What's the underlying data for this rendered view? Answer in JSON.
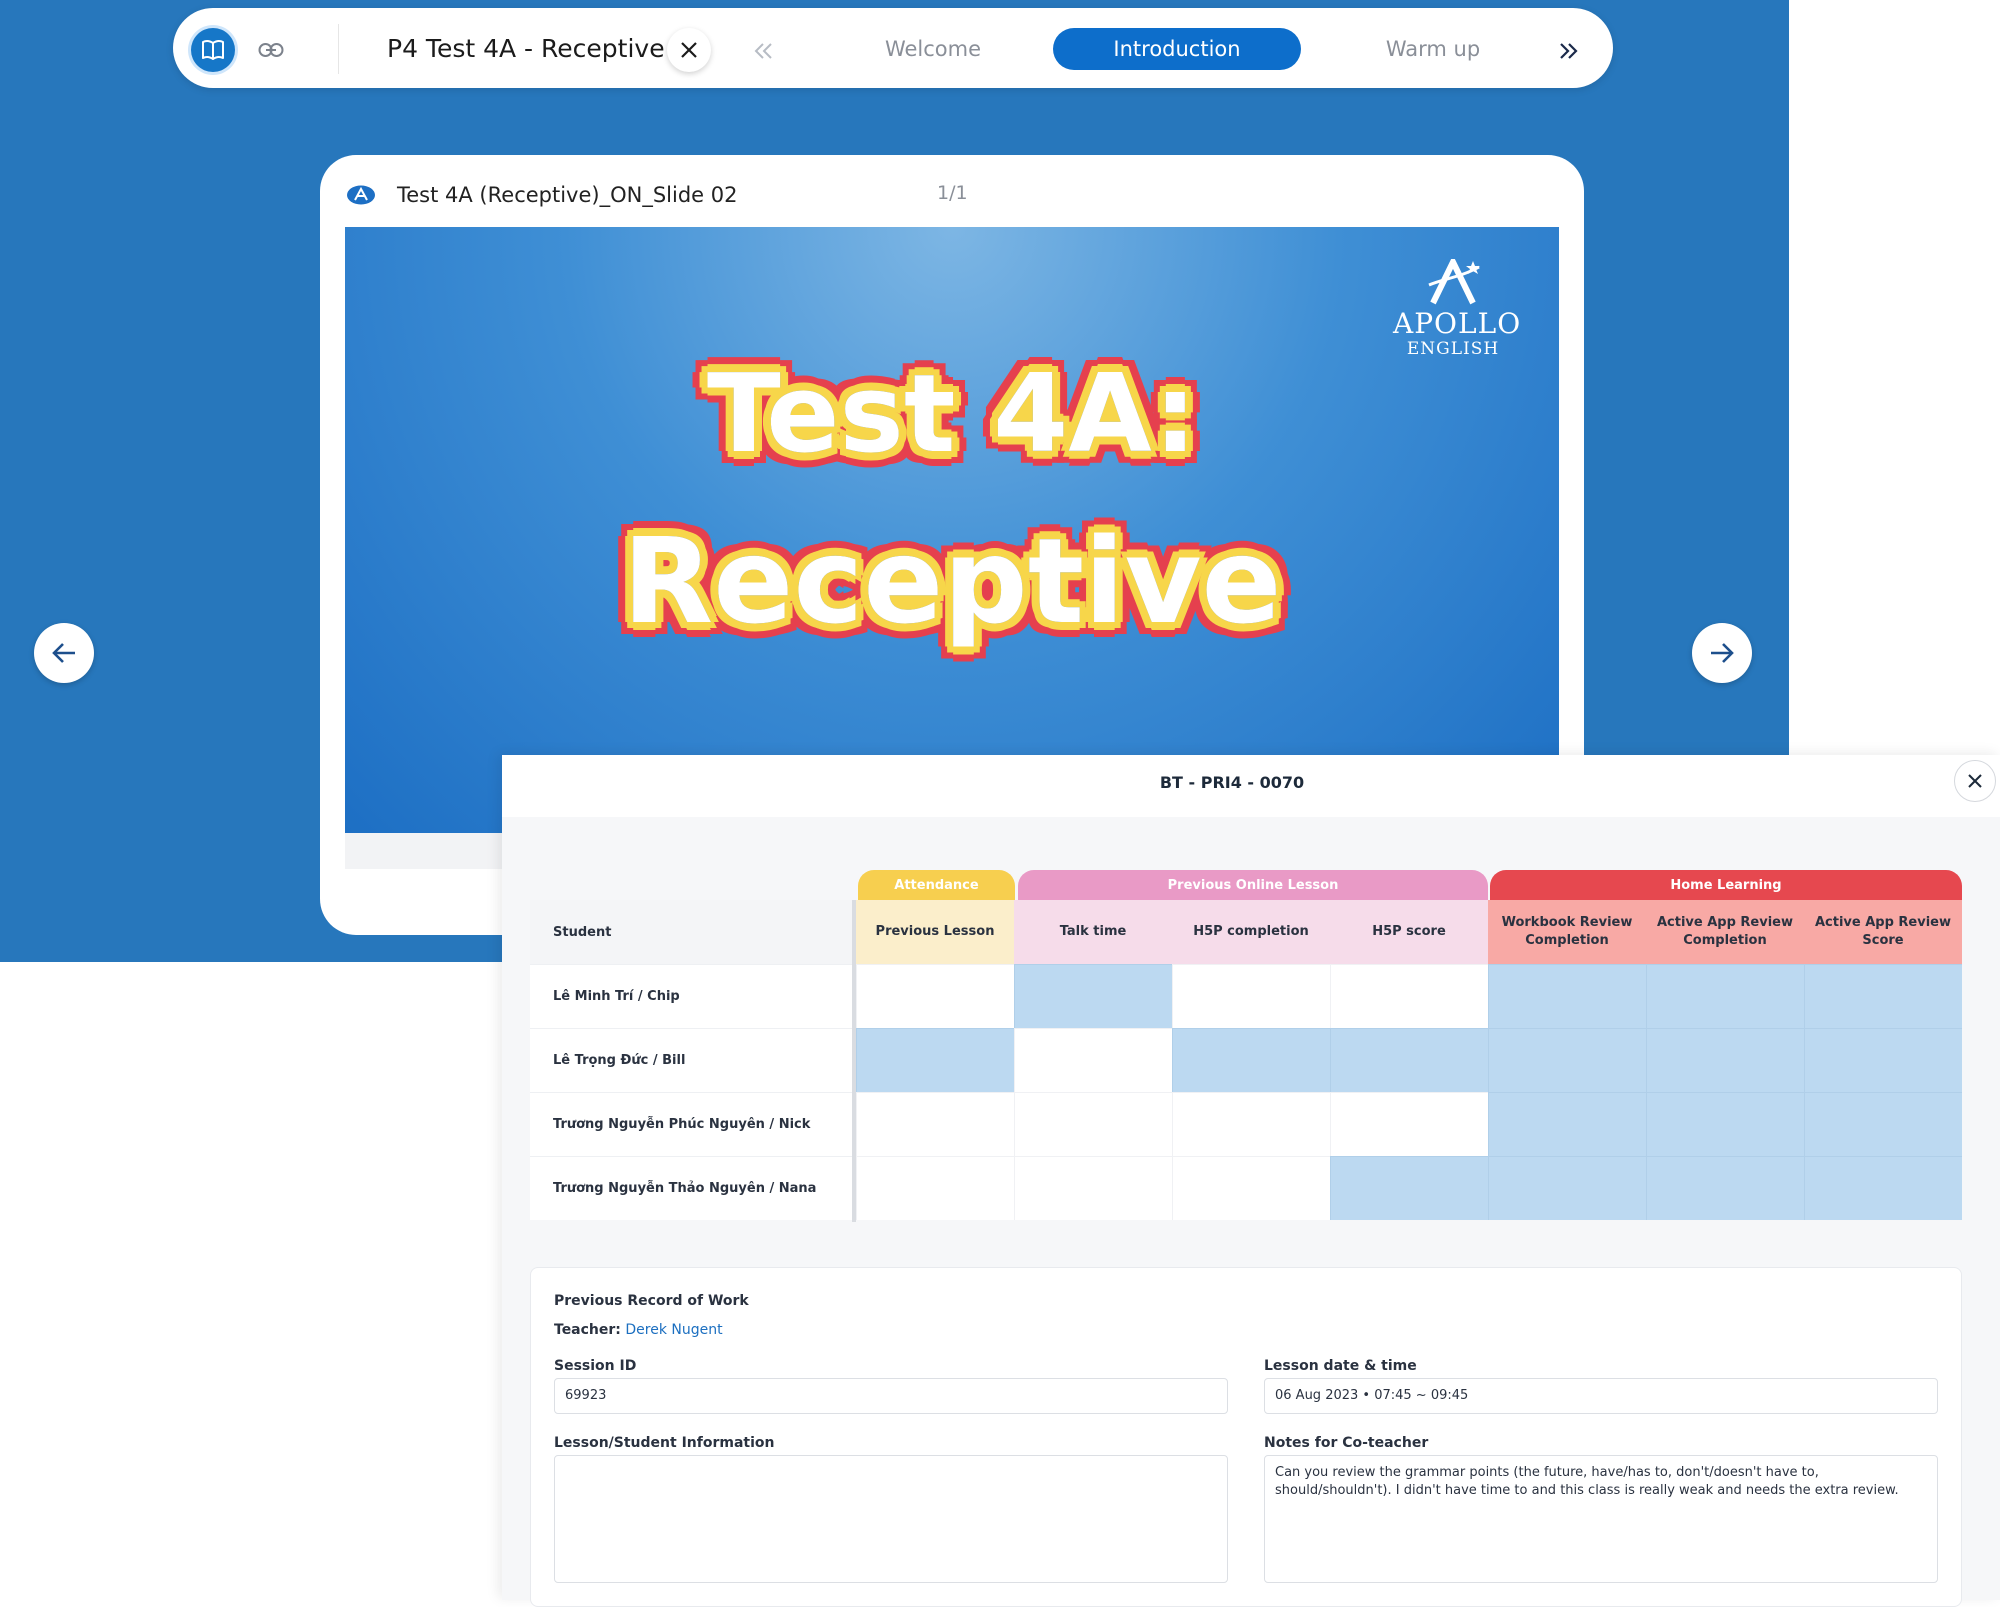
{
  "topbar": {
    "lesson_title": "P4 Test 4A - Receptive",
    "tabs": [
      {
        "label": "Welcome",
        "active": false
      },
      {
        "label": "Introduction",
        "active": true
      },
      {
        "label": "Warm up",
        "active": false
      }
    ],
    "icons": [
      "book-icon",
      "link-icon",
      "close-icon",
      "chevrons-left-icon",
      "chevrons-right-icon"
    ]
  },
  "slide": {
    "name": "Test 4A (Receptive)_ON_Slide 02",
    "counter": "1/1",
    "brand_name": "APOLLO",
    "brand_sub": "ENGLISH",
    "title_line1": "Test 4A:",
    "title_line2": "Receptive"
  },
  "panel": {
    "title": "BT - PRI4 - 0070",
    "groups": [
      {
        "label": "Attendance",
        "color": "#f7cf4f"
      },
      {
        "label": "Previous Online Lesson",
        "color": "#e99ac6"
      },
      {
        "label": "Home Learning",
        "color": "#e6484f"
      }
    ],
    "student_header": "Student",
    "columns": [
      {
        "label": "Previous Lesson",
        "bg": "#fbeecb"
      },
      {
        "label": "Talk time",
        "bg": "#f6dcea"
      },
      {
        "label": "H5P completion",
        "bg": "#f6dcea"
      },
      {
        "label": "H5P score",
        "bg": "#f6dcea"
      },
      {
        "label": "Workbook Review Completion",
        "bg": "#f8a9a5"
      },
      {
        "label": "Active App Review Completion",
        "bg": "#f8a9a5"
      },
      {
        "label": "Active App Review Score",
        "bg": "#f8a9a5"
      }
    ],
    "students": [
      {
        "name": "Lê Minh Trí / Chip",
        "highlights": [
          false,
          true,
          false,
          false,
          true,
          true,
          true
        ]
      },
      {
        "name": "Lê Trọng Đức / Bill",
        "highlights": [
          true,
          false,
          true,
          true,
          true,
          true,
          true
        ]
      },
      {
        "name": "Trương Nguyễn Phúc Nguyên / Nick",
        "highlights": [
          false,
          false,
          false,
          false,
          true,
          true,
          true
        ]
      },
      {
        "name": "Trương Nguyễn Thảo Nguyên / Nana",
        "highlights": [
          false,
          false,
          false,
          true,
          true,
          true,
          true
        ]
      }
    ],
    "record": {
      "heading": "Previous Record of Work",
      "teacher_label": "Teacher:",
      "teacher_name": "Derek Nugent",
      "session_label": "Session ID",
      "session_value": "69923",
      "date_label": "Lesson date & time",
      "date_value": "06 Aug 2023 • 07:45 ~ 09:45",
      "info_label": "Lesson/Student Information",
      "info_value": "",
      "notes_label": "Notes for Co-teacher",
      "notes_value": "Can you review the grammar points (the future, have/has to, don't/doesn't have to, should/shouldn't). I didn't have time to and this class is really weak and needs the extra review."
    }
  },
  "colors": {
    "stage": "#2777bc",
    "accent": "#0d6ecb",
    "highlight_cell": "#bcd9f1"
  }
}
